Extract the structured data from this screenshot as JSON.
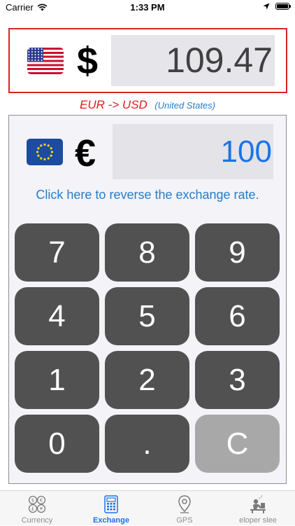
{
  "status_bar": {
    "carrier": "Carrier",
    "time": "1:33 PM"
  },
  "result": {
    "flag": "us-flag",
    "symbol": "$",
    "value": "109.47"
  },
  "conversion": {
    "pair": "EUR -> USD",
    "country": "(United States)"
  },
  "input": {
    "flag": "eu-flag",
    "symbol": "€",
    "value": "100"
  },
  "reverse_link": "Click here to reverse the exchange rate.",
  "keypad": {
    "k7": "7",
    "k8": "8",
    "k9": "9",
    "k4": "4",
    "k5": "5",
    "k6": "6",
    "k1": "1",
    "k2": "2",
    "k3": "3",
    "k0": "0",
    "kdot": ".",
    "kclear": "C"
  },
  "tabs": [
    {
      "label": "Currency",
      "icon": "currency-coins-icon"
    },
    {
      "label": "Exchange",
      "icon": "calculator-icon",
      "active": true
    },
    {
      "label": "GPS",
      "icon": "location-pin-icon"
    },
    {
      "label": "eloper slee",
      "icon": "sleeping-developer-icon"
    }
  ],
  "colors": {
    "highlight_border": "#d62628",
    "accent_blue": "#1a73e8",
    "key_dark": "#515151",
    "key_clear": "#a8a8a8",
    "pair_red": "#e0191e"
  }
}
